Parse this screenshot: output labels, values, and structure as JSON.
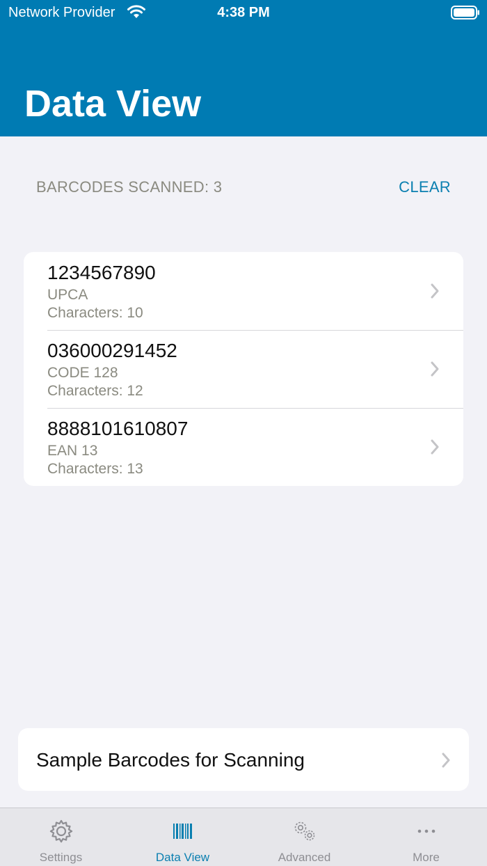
{
  "status_bar": {
    "carrier": "Network Provider",
    "time": "4:38 PM"
  },
  "header": {
    "title": "Data View",
    "background_color": "#007bb3"
  },
  "summary": {
    "scanned_label": "BARCODES SCANNED: 3",
    "clear_label": "CLEAR"
  },
  "barcodes": [
    {
      "value": "1234567890",
      "type": "UPCA",
      "characters": "Characters: 10"
    },
    {
      "value": "036000291452",
      "type": "CODE 128",
      "characters": "Characters: 12"
    },
    {
      "value": "8888101610807",
      "type": "EAN 13",
      "characters": "Characters: 13"
    }
  ],
  "sample": {
    "label": "Sample Barcodes for Scanning"
  },
  "tabs": [
    {
      "label": "Settings",
      "icon": "gear-icon"
    },
    {
      "label": "Data View",
      "icon": "barcode-icon"
    },
    {
      "label": "Advanced",
      "icon": "gears-icon"
    },
    {
      "label": "More",
      "icon": "more-dots-icon"
    }
  ],
  "accent_color": "#0a7fb0"
}
